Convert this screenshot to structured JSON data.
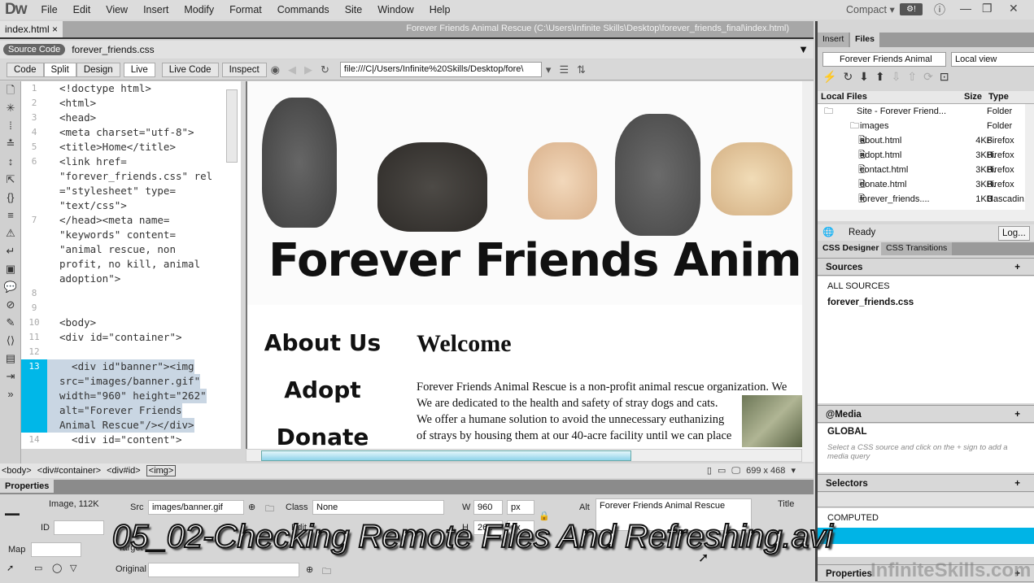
{
  "app": {
    "logo": "Dw",
    "workspace": "Compact",
    "workspace_arrow": "▾"
  },
  "menu": [
    "File",
    "Edit",
    "View",
    "Insert",
    "Modify",
    "Format",
    "Commands",
    "Site",
    "Window",
    "Help"
  ],
  "window_controls": {
    "info": "ⓘ",
    "minimize": "—",
    "restore": "❐",
    "close": "✕"
  },
  "document": {
    "tab": "index.html",
    "tab_close": "×",
    "path_title": "Forever Friends Animal Rescue (C:\\Users\\Infinite Skills\\Desktop\\forever_friends_final\\index.html)",
    "source_code_label": "Source Code",
    "related_file": "forever_friends.css"
  },
  "toolbar": {
    "views": [
      "Code",
      "Split",
      "Design",
      "Live"
    ],
    "live_code": "Live Code",
    "inspect": "Inspect",
    "url": "file:///C|/Users/Infinite%20Skills/Desktop/fore\\"
  },
  "code": {
    "lines": [
      {
        "n": "1",
        "text": "<!doctype html>"
      },
      {
        "n": "2",
        "text": "<html>"
      },
      {
        "n": "3",
        "text": "<head>"
      },
      {
        "n": "4",
        "text": "<meta charset=\"utf-8\">"
      },
      {
        "n": "5",
        "text": "<title>Home</title>"
      },
      {
        "n": "6",
        "text": "<link href="
      },
      {
        "n": "",
        "text": "\"forever_friends.css\" rel"
      },
      {
        "n": "",
        "text": "=\"stylesheet\" type="
      },
      {
        "n": "",
        "text": "\"text/css\">"
      },
      {
        "n": "7",
        "text": "</head><meta name="
      },
      {
        "n": "",
        "text": "\"keywords\" content="
      },
      {
        "n": "",
        "text": "\"animal rescue, non"
      },
      {
        "n": "",
        "text": "profit, no kill, animal"
      },
      {
        "n": "",
        "text": "adoption\">"
      },
      {
        "n": "8",
        "text": ""
      },
      {
        "n": "9",
        "text": ""
      },
      {
        "n": "10",
        "text": "<body>"
      },
      {
        "n": "11",
        "text": "<div id=\"container\">"
      },
      {
        "n": "12",
        "text": ""
      },
      {
        "n": "13",
        "text": "  <div id\"banner\"><img",
        "sel": true
      },
      {
        "n": "",
        "text": "src=\"images/banner.gif\"",
        "sel": true
      },
      {
        "n": "",
        "text": "width=\"960\" height=\"262\"",
        "sel": true
      },
      {
        "n": "",
        "text": "alt=\"Forever Friends",
        "sel": true
      },
      {
        "n": "",
        "text": "Animal Rescue\"/></div>",
        "sel": true
      },
      {
        "n": "14",
        "text": "  <div id=\"content\">"
      }
    ]
  },
  "design": {
    "banner_text": "Forever Friends Anima",
    "nav": [
      "About Us",
      "Adopt",
      "Donate"
    ],
    "heading": "Welcome",
    "body_lines": [
      "Forever Friends Animal Rescue is a non-profit animal rescue organization. We",
      "We are dedicated to the health and safety of stray dogs and cats.",
      "We offer a humane solution to avoid the unnecessary euthanizing",
      "of strays by housing them at our 40-acre facility until we can place"
    ]
  },
  "tag_selector": [
    "<body>",
    "<div#container>",
    "<div#id>",
    "<img>"
  ],
  "viewport_size": "699 x 468",
  "properties": {
    "title": "Properties",
    "type_label": "Image, 112K",
    "id_label": "ID",
    "src_label": "Src",
    "src_value": "images/banner.gif",
    "class_label": "Class",
    "class_value": "None",
    "w_label": "W",
    "w_value": "960",
    "h_label": "H",
    "h_value": "262",
    "unit": "px",
    "alt_label": "Alt",
    "alt_value": "Forever Friends Animal Rescue",
    "title_label": "Title",
    "edit_label": "Edit",
    "map_label": "Map",
    "target_label": "Target",
    "original_label": "Original"
  },
  "files_panel": {
    "tabs": [
      "Insert",
      "Files"
    ],
    "site": "Forever Friends Animal",
    "view": "Local view",
    "headers": {
      "name": "Local Files",
      "size": "Size",
      "type": "Type"
    },
    "rows": [
      {
        "name": "Site - Forever Friend...",
        "size": "",
        "type": "Folder"
      },
      {
        "name": "images",
        "size": "",
        "type": "Folder"
      },
      {
        "name": "about.html",
        "size": "4KB",
        "type": "Firefox H."
      },
      {
        "name": "adopt.html",
        "size": "3KB",
        "type": "Firefox H."
      },
      {
        "name": "contact.html",
        "size": "3KB",
        "type": "Firefox H."
      },
      {
        "name": "donate.html",
        "size": "3KB",
        "type": "Firefox H."
      },
      {
        "name": "forever_friends....",
        "size": "1KB",
        "type": "Cascadin."
      }
    ],
    "status": "Ready",
    "log": "Log..."
  },
  "css_panel": {
    "tabs": [
      "CSS Designer",
      "CSS Transitions"
    ],
    "sources": "Sources",
    "all_sources": "ALL SOURCES",
    "source_file": "forever_friends.css",
    "media": "@Media",
    "global": "GLOBAL",
    "media_hint": "Select a CSS source and click on the + sign to add a media query",
    "selectors": "Selectors",
    "computed": "COMPUTED",
    "properties": "Properties"
  },
  "overlay": {
    "subtitle": "05_02-Checking Remote Files And Refreshing.avi",
    "watermark": "InfiniteSkills.com"
  }
}
